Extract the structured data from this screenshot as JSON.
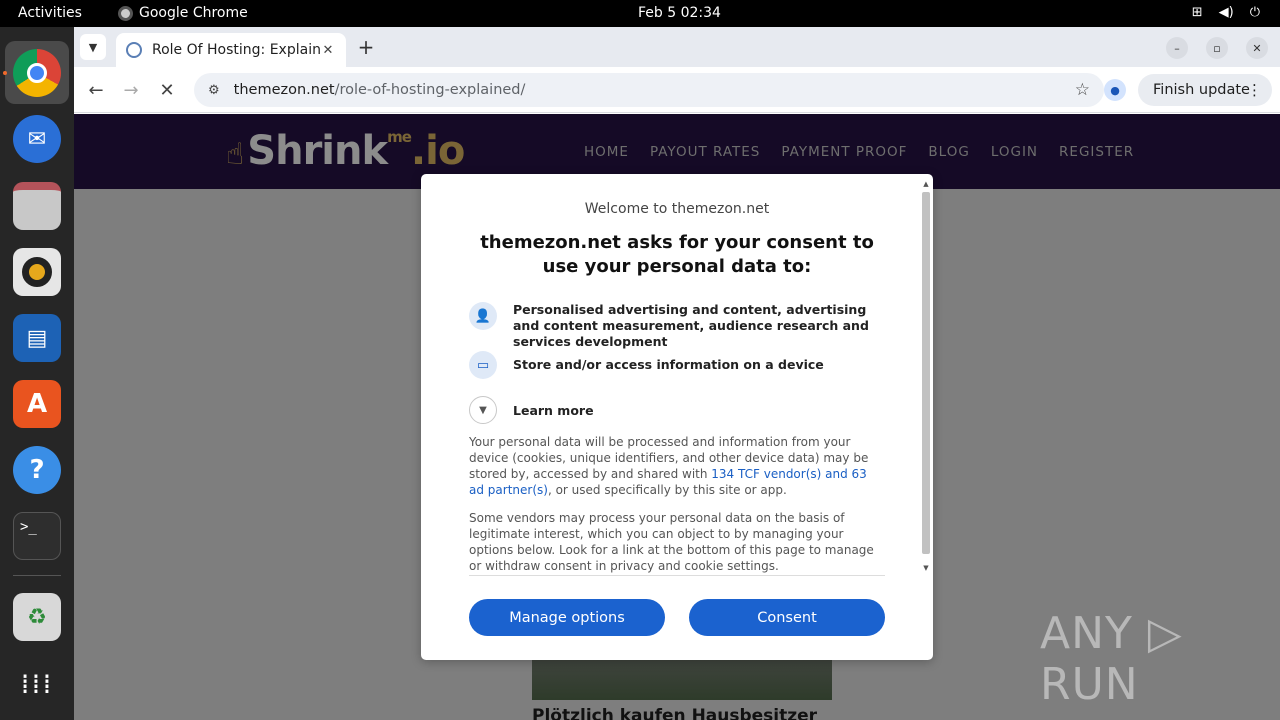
{
  "topbar": {
    "activities": "Activities",
    "app_name": "Google Chrome",
    "clock": "Feb 5  02:34",
    "tray": [
      "network-icon",
      "volume-icon",
      "power-icon"
    ]
  },
  "dock": {
    "items": [
      "chrome-icon",
      "thunderbird-icon",
      "files-icon",
      "rhythmbox-icon",
      "writer-icon",
      "app-center-icon",
      "help-icon",
      "terminal-icon",
      "trash-icon",
      "app-grid-icon"
    ]
  },
  "browser": {
    "tab_title": "Role Of Hosting: Explain",
    "url_host": "themezon.net",
    "url_path": "/role-of-hosting-explained/",
    "update_label": "Finish update"
  },
  "site": {
    "logo_main": "Shrink",
    "logo_me": "me",
    "logo_io": ".io",
    "nav": [
      "HOME",
      "PAYOUT RATES",
      "PAYMENT PROOF",
      "BLOG",
      "LOGIN",
      "REGISTER"
    ],
    "article_title": "Plötzlich kaufen Hausbesitzer"
  },
  "consent": {
    "welcome": "Welcome to themezon.net",
    "headline": "themezon.net asks for your consent to use your personal data to:",
    "purposes": [
      "Personalised advertising and content, advertising and content measurement, audience research and services development",
      "Store and/or access information on a device"
    ],
    "learn_more": "Learn more",
    "para1_a": "Your personal data will be processed and information from your device (cookies, unique identifiers, and other device data) may be stored by, accessed by and shared with ",
    "para1_link": "134 TCF vendor(s) and 63 ad partner(s)",
    "para1_b": ", or used specifically by this site or app.",
    "para2": "Some vendors may process your personal data on the basis of legitimate interest, which you can object to by managing your options below. Look for a link at the bottom of this page to manage or withdraw consent in privacy and cookie settings.",
    "manage_label": "Manage options",
    "consent_label": "Consent"
  },
  "watermark": "ANY ▷ RUN",
  "colors": {
    "accent": "#1b62cf",
    "site_header": "#150a26"
  }
}
